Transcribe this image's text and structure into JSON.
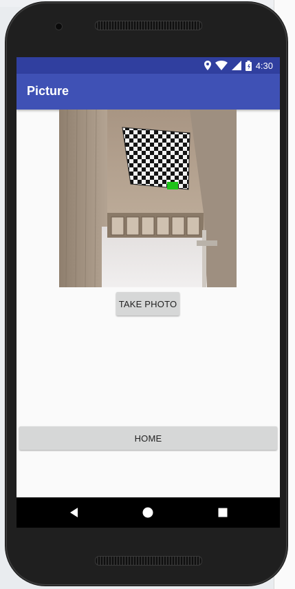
{
  "status_bar": {
    "time": "4:30",
    "icons": [
      "location-icon",
      "wifi-icon",
      "signal-icon",
      "battery-icon"
    ]
  },
  "app_bar": {
    "title": "Picture"
  },
  "photo": {
    "description": "captured-photo",
    "accent": "#1fc31a"
  },
  "buttons": {
    "take_photo": "TAKE PHOTO",
    "home": "HOME"
  },
  "nav": {
    "icons": [
      "back-icon",
      "home-circle-icon",
      "recents-icon"
    ]
  },
  "colors": {
    "status_bar": "#303f9f",
    "app_bar": "#3f51b5",
    "button": "#d6d7d7"
  }
}
